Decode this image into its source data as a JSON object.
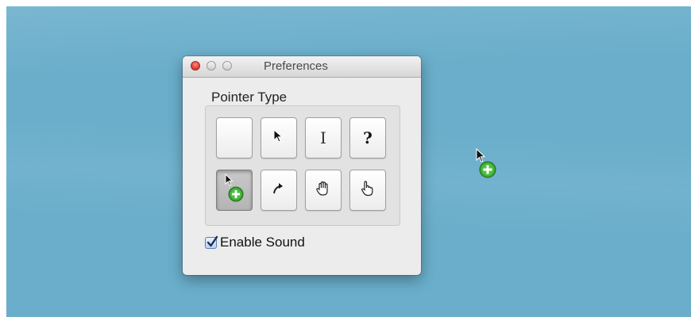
{
  "window": {
    "title": "Preferences"
  },
  "pointer_group": {
    "label": "Pointer Type",
    "buttons": [
      {
        "name": "blank",
        "icon": "empty",
        "selected": false
      },
      {
        "name": "arrow",
        "icon": "arrow-pointer-icon",
        "selected": false
      },
      {
        "name": "ibeam",
        "icon": "text-cursor-icon",
        "glyph": "I",
        "selected": false
      },
      {
        "name": "help",
        "icon": "question-icon",
        "glyph": "?",
        "selected": false
      },
      {
        "name": "copy",
        "icon": "copy-cursor-icon",
        "selected": true
      },
      {
        "name": "alias",
        "icon": "alias-cursor-icon",
        "selected": false
      },
      {
        "name": "grab",
        "icon": "open-hand-icon",
        "selected": false
      },
      {
        "name": "point",
        "icon": "pointing-hand-icon",
        "selected": false
      }
    ]
  },
  "enable_sound": {
    "label": "Enable Sound",
    "checked": true
  },
  "colors": {
    "desktop": "#6aaecb",
    "copy_badge": "#3fa535",
    "close_button": "#d9362b"
  }
}
